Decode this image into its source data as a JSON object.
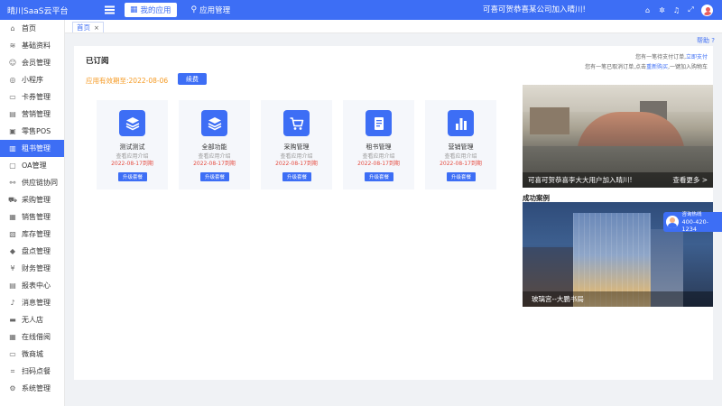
{
  "app": {
    "title": "晴川SaaS云平台"
  },
  "topnav": {
    "items": [
      {
        "label": "我的应用",
        "active": true
      },
      {
        "label": "应用管理",
        "active": false
      }
    ],
    "marquee": "可喜可贺恭喜某公司加入晴川!"
  },
  "sidebar": {
    "items": [
      {
        "label": "首页",
        "icon": "home-icon"
      },
      {
        "label": "基础资料",
        "icon": "layers-icon"
      },
      {
        "label": "会员管理",
        "icon": "user-icon"
      },
      {
        "label": "小程序",
        "icon": "miniapp-icon"
      },
      {
        "label": "卡券管理",
        "icon": "card-icon"
      },
      {
        "label": "营销管理",
        "icon": "chart-icon"
      },
      {
        "label": "零售POS",
        "icon": "pos-icon"
      },
      {
        "label": "租书管理",
        "icon": "book-icon",
        "active": true
      },
      {
        "label": "OA管理",
        "icon": "oa-icon"
      },
      {
        "label": "供应链协同",
        "icon": "supply-icon"
      },
      {
        "label": "采购管理",
        "icon": "cart-icon"
      },
      {
        "label": "销售管理",
        "icon": "sales-icon"
      },
      {
        "label": "库存管理",
        "icon": "stock-icon"
      },
      {
        "label": "盘点管理",
        "icon": "count-icon"
      },
      {
        "label": "财务管理",
        "icon": "finance-icon"
      },
      {
        "label": "报表中心",
        "icon": "report-icon"
      },
      {
        "label": "消息管理",
        "icon": "bell-icon"
      },
      {
        "label": "无人店",
        "icon": "store-icon"
      },
      {
        "label": "在线借阅",
        "icon": "read-icon"
      },
      {
        "label": "微商城",
        "icon": "mall-icon"
      },
      {
        "label": "扫码点餐",
        "icon": "scan-icon"
      },
      {
        "label": "系统管理",
        "icon": "gear-icon"
      }
    ]
  },
  "tabs": [
    {
      "label": "首页"
    }
  ],
  "help": "帮助 ?",
  "main": {
    "title": "已订阅",
    "notice1_pre": "您有一笔待支付订单,",
    "notice1_link": "立即支付",
    "notice2_pre": "您有一笔已取消订单,点击",
    "notice2_link": "重新购买",
    "notice2_post": ",一键加入购物车",
    "expire": "应用有效期至:2022-08-06",
    "renew": "续费",
    "cards": [
      {
        "name": "测试测试",
        "desc": "查看应用介绍",
        "date": "2022-08-17到期",
        "btn": "升级套餐",
        "icon": "layers-icon"
      },
      {
        "name": "全部功能",
        "desc": "查看应用介绍",
        "date": "2022-08-17到期",
        "btn": "升级套餐",
        "icon": "layers-icon"
      },
      {
        "name": "采购管理",
        "desc": "查看应用介绍",
        "date": "2022-08-17到期",
        "btn": "升级套餐",
        "icon": "cart-icon"
      },
      {
        "name": "租书管理",
        "desc": "查看应用介绍",
        "date": "2022-08-17到期",
        "btn": "升级套餐",
        "icon": "document-icon"
      },
      {
        "name": "营销管理",
        "desc": "查看应用介绍",
        "date": "2022-08-17到期",
        "btn": "升级套餐",
        "icon": "bar-chart-icon"
      }
    ]
  },
  "promo": {
    "caption": "可喜可贺恭喜李大大用户加入晴川!",
    "more": "查看更多 >"
  },
  "cases": {
    "title": "成功案例",
    "caption": "玻璃宫--大鹏书局"
  },
  "service": {
    "line1": "咨询热线",
    "line2": "400-420-1234"
  },
  "colors": {
    "primary": "#3d6ef5",
    "warning": "#f59a23",
    "danger": "#e54d42"
  }
}
